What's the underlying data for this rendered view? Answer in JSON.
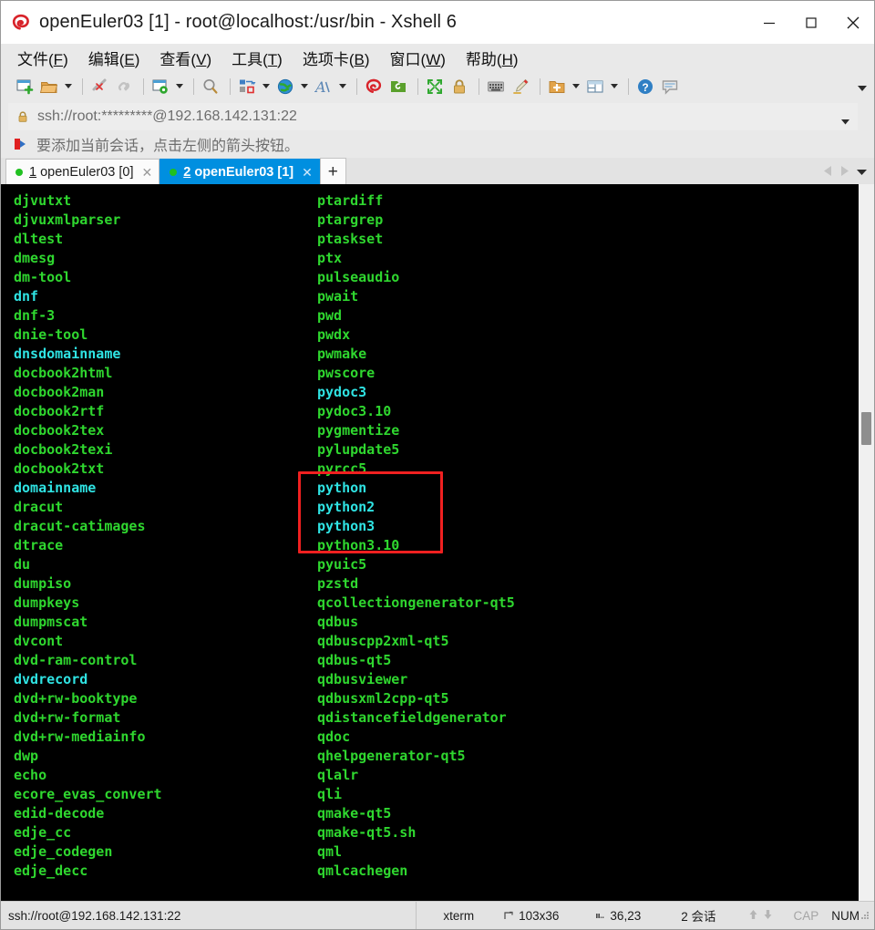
{
  "window": {
    "title": "openEuler03 [1] - root@localhost:/usr/bin - Xshell 6",
    "app_icon": "xshell-logo-icon",
    "controls": {
      "minimize": "minimize-icon",
      "maximize": "maximize-icon",
      "close": "close-icon"
    }
  },
  "menubar": [
    {
      "label": "文件",
      "accel": "F"
    },
    {
      "label": "编辑",
      "accel": "E"
    },
    {
      "label": "查看",
      "accel": "V"
    },
    {
      "label": "工具",
      "accel": "T"
    },
    {
      "label": "选项卡",
      "accel": "B"
    },
    {
      "label": "窗口",
      "accel": "W"
    },
    {
      "label": "帮助",
      "accel": "H"
    }
  ],
  "toolbar": {
    "items": [
      {
        "name": "new-session-icon",
        "caret": false
      },
      {
        "name": "open-folder-icon",
        "caret": true
      },
      {
        "name": "disconnect-icon",
        "caret": false
      },
      {
        "name": "reconnect-icon",
        "caret": false
      },
      {
        "name": "session-properties-icon",
        "caret": true
      },
      {
        "name": "find-icon",
        "caret": false
      },
      {
        "name": "transfer-file-icon",
        "caret": true
      },
      {
        "name": "globe-encoding-icon",
        "caret": true
      },
      {
        "name": "font-icon",
        "caret": true
      },
      {
        "name": "xshell-logo-icon",
        "caret": false
      },
      {
        "name": "xftp-icon",
        "caret": false
      },
      {
        "name": "fullscreen-icon",
        "caret": false
      },
      {
        "name": "lock-icon",
        "caret": false
      },
      {
        "name": "keyboard-icon",
        "caret": false
      },
      {
        "name": "highlight-pen-icon",
        "caret": false
      },
      {
        "name": "new-folder-icon",
        "caret": true
      },
      {
        "name": "layout-icon",
        "caret": true
      },
      {
        "name": "help-icon",
        "caret": false
      },
      {
        "name": "chat-icon",
        "caret": false
      }
    ],
    "overflow": "toolbar-overflow-icon"
  },
  "address_bar": {
    "lock_icon": "lock-icon",
    "value": "ssh://root:*********@192.168.142.131:22",
    "dropdown_icon": "chevron-down-icon"
  },
  "notice_bar": {
    "icon": "add-to-favorites-icon",
    "text": "要添加当前会话，点击左侧的箭头按钮。"
  },
  "tabs": {
    "items": [
      {
        "index": "1",
        "label": "openEuler03 [0]",
        "active": false,
        "status": "connected",
        "close_icon": "close-icon"
      },
      {
        "index": "2",
        "label": "openEuler03 [1]",
        "active": true,
        "status": "connected",
        "close_icon": "close-icon"
      }
    ],
    "new_tab_label": "+",
    "nav_prev_icon": "chevron-left-icon",
    "nav_next_icon": "chevron-right-icon",
    "nav_list_icon": "chevron-down-icon"
  },
  "terminal": {
    "background": "#000000",
    "color_green": "#2fd72f",
    "color_cyan": "#2fe3e3",
    "column1": [
      {
        "text": "djvutxt",
        "color": "green"
      },
      {
        "text": "djvuxmlparser",
        "color": "green"
      },
      {
        "text": "dltest",
        "color": "green"
      },
      {
        "text": "dmesg",
        "color": "green"
      },
      {
        "text": "dm-tool",
        "color": "green"
      },
      {
        "text": "dnf",
        "color": "cyan"
      },
      {
        "text": "dnf-3",
        "color": "green"
      },
      {
        "text": "dnie-tool",
        "color": "green"
      },
      {
        "text": "dnsdomainname",
        "color": "cyan"
      },
      {
        "text": "docbook2html",
        "color": "green"
      },
      {
        "text": "docbook2man",
        "color": "green"
      },
      {
        "text": "docbook2rtf",
        "color": "green"
      },
      {
        "text": "docbook2tex",
        "color": "green"
      },
      {
        "text": "docbook2texi",
        "color": "green"
      },
      {
        "text": "docbook2txt",
        "color": "green"
      },
      {
        "text": "domainname",
        "color": "cyan"
      },
      {
        "text": "dracut",
        "color": "green"
      },
      {
        "text": "dracut-catimages",
        "color": "green"
      },
      {
        "text": "dtrace",
        "color": "green"
      },
      {
        "text": "du",
        "color": "green"
      },
      {
        "text": "dumpiso",
        "color": "green"
      },
      {
        "text": "dumpkeys",
        "color": "green"
      },
      {
        "text": "dumpmscat",
        "color": "green"
      },
      {
        "text": "dvcont",
        "color": "green"
      },
      {
        "text": "dvd-ram-control",
        "color": "green"
      },
      {
        "text": "dvdrecord",
        "color": "cyan"
      },
      {
        "text": "dvd+rw-booktype",
        "color": "green"
      },
      {
        "text": "dvd+rw-format",
        "color": "green"
      },
      {
        "text": "dvd+rw-mediainfo",
        "color": "green"
      },
      {
        "text": "dwp",
        "color": "green"
      },
      {
        "text": "echo",
        "color": "green"
      },
      {
        "text": "ecore_evas_convert",
        "color": "green"
      },
      {
        "text": "edid-decode",
        "color": "green"
      },
      {
        "text": "edje_cc",
        "color": "green"
      },
      {
        "text": "edje_codegen",
        "color": "green"
      },
      {
        "text": "edje_decc",
        "color": "green"
      }
    ],
    "column2": [
      {
        "text": "ptardiff",
        "color": "green"
      },
      {
        "text": "ptargrep",
        "color": "green"
      },
      {
        "text": "ptaskset",
        "color": "green"
      },
      {
        "text": "ptx",
        "color": "green"
      },
      {
        "text": "pulseaudio",
        "color": "green"
      },
      {
        "text": "pwait",
        "color": "green"
      },
      {
        "text": "pwd",
        "color": "green"
      },
      {
        "text": "pwdx",
        "color": "green"
      },
      {
        "text": "pwmake",
        "color": "green"
      },
      {
        "text": "pwscore",
        "color": "green"
      },
      {
        "text": "pydoc3",
        "color": "cyan"
      },
      {
        "text": "pydoc3.10",
        "color": "green"
      },
      {
        "text": "pygmentize",
        "color": "green"
      },
      {
        "text": "pylupdate5",
        "color": "green"
      },
      {
        "text": "pyrcc5",
        "color": "green"
      },
      {
        "text": "python",
        "color": "cyan"
      },
      {
        "text": "python2",
        "color": "cyan"
      },
      {
        "text": "python3",
        "color": "cyan"
      },
      {
        "text": "python3.10",
        "color": "green"
      },
      {
        "text": "pyuic5",
        "color": "green"
      },
      {
        "text": "pzstd",
        "color": "green"
      },
      {
        "text": "qcollectiongenerator-qt5",
        "color": "green"
      },
      {
        "text": "qdbus",
        "color": "green"
      },
      {
        "text": "qdbuscpp2xml-qt5",
        "color": "green"
      },
      {
        "text": "qdbus-qt5",
        "color": "green"
      },
      {
        "text": "qdbusviewer",
        "color": "green"
      },
      {
        "text": "qdbusxml2cpp-qt5",
        "color": "green"
      },
      {
        "text": "qdistancefieldgenerator",
        "color": "green"
      },
      {
        "text": "qdoc",
        "color": "green"
      },
      {
        "text": "qhelpgenerator-qt5",
        "color": "green"
      },
      {
        "text": "qlalr",
        "color": "green"
      },
      {
        "text": "qli",
        "color": "green"
      },
      {
        "text": "qmake-qt5",
        "color": "green"
      },
      {
        "text": "qmake-qt5.sh",
        "color": "green"
      },
      {
        "text": "qml",
        "color": "green"
      },
      {
        "text": "qmlcachegen",
        "color": "green"
      }
    ],
    "highlight": {
      "color": "#f02020",
      "entries": [
        "python",
        "python2",
        "python3",
        "python3.10"
      ]
    }
  },
  "statusbar": {
    "host_icon": "connection-icon",
    "host": "ssh://root@192.168.142.131:22",
    "terminal_type": "xterm",
    "size_icon": "size-icon",
    "size": "103x36",
    "cursor_icon": "cursor-icon",
    "cursor": "36,23",
    "sessions": "2 会话",
    "upload_icon": "arrow-up-icon",
    "download_icon": "arrow-down-icon",
    "caps": "CAP",
    "num": "NUM",
    "grip": "resize-grip-icon"
  }
}
